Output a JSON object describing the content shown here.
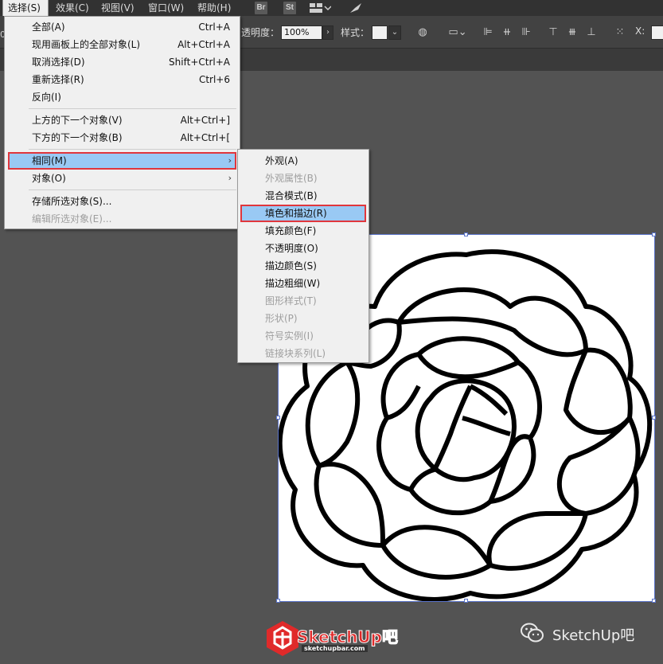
{
  "menubar": {
    "items": [
      {
        "label": "选择(S)",
        "active": true
      },
      {
        "label": "效果(C)"
      },
      {
        "label": "视图(V)"
      },
      {
        "label": "窗口(W)"
      },
      {
        "label": "帮助(H)"
      }
    ],
    "icons": [
      {
        "name": "bridge-icon",
        "text": "Br"
      },
      {
        "name": "stock-icon",
        "text": "St"
      }
    ]
  },
  "controlbar": {
    "left_fragment": "0",
    "opacity_label": "透明度：",
    "opacity_value": "100%",
    "style_label": "样式：",
    "x_label": "X:"
  },
  "select_menu": {
    "groups": [
      [
        {
          "label": "全部(A)",
          "shortcut": "Ctrl+A"
        },
        {
          "label": "现用画板上的全部对象(L)",
          "shortcut": "Alt+Ctrl+A"
        },
        {
          "label": "取消选择(D)",
          "shortcut": "Shift+Ctrl+A"
        },
        {
          "label": "重新选择(R)",
          "shortcut": "Ctrl+6"
        },
        {
          "label": "反向(I)",
          "shortcut": ""
        }
      ],
      [
        {
          "label": "上方的下一个对象(V)",
          "shortcut": "Alt+Ctrl+]"
        },
        {
          "label": "下方的下一个对象(B)",
          "shortcut": "Alt+Ctrl+["
        }
      ],
      [
        {
          "label": "相同(M)",
          "submenu": true,
          "highlighted": true
        },
        {
          "label": "对象(O)",
          "submenu": true
        }
      ],
      [
        {
          "label": "存储所选对象(S)...",
          "shortcut": ""
        },
        {
          "label": "编辑所选对象(E)...",
          "shortcut": "",
          "disabled": true
        }
      ]
    ]
  },
  "same_submenu": {
    "items": [
      {
        "label": "外观(A)"
      },
      {
        "label": "外观属性(B)",
        "disabled": true
      },
      {
        "label": "混合模式(B)"
      },
      {
        "label": "填色和描边(R)",
        "highlighted": true
      },
      {
        "label": "填充颜色(F)"
      },
      {
        "label": "不透明度(O)"
      },
      {
        "label": "描边颜色(S)"
      },
      {
        "label": "描边粗细(W)"
      },
      {
        "label": "图形样式(T)",
        "disabled": true
      },
      {
        "label": "形状(P)",
        "disabled": true
      },
      {
        "label": "符号实例(I)",
        "disabled": true
      },
      {
        "label": "链接块系列(L)",
        "disabled": true
      }
    ]
  },
  "watermark": {
    "logo_text": "SketchUp吧",
    "logo_url": "sketchupbar.com",
    "wechat_label": "SketchUp吧"
  },
  "colors": {
    "highlight": "#99c9f4",
    "highlight_border": "#e0363c",
    "selection": "#5a73c8"
  }
}
